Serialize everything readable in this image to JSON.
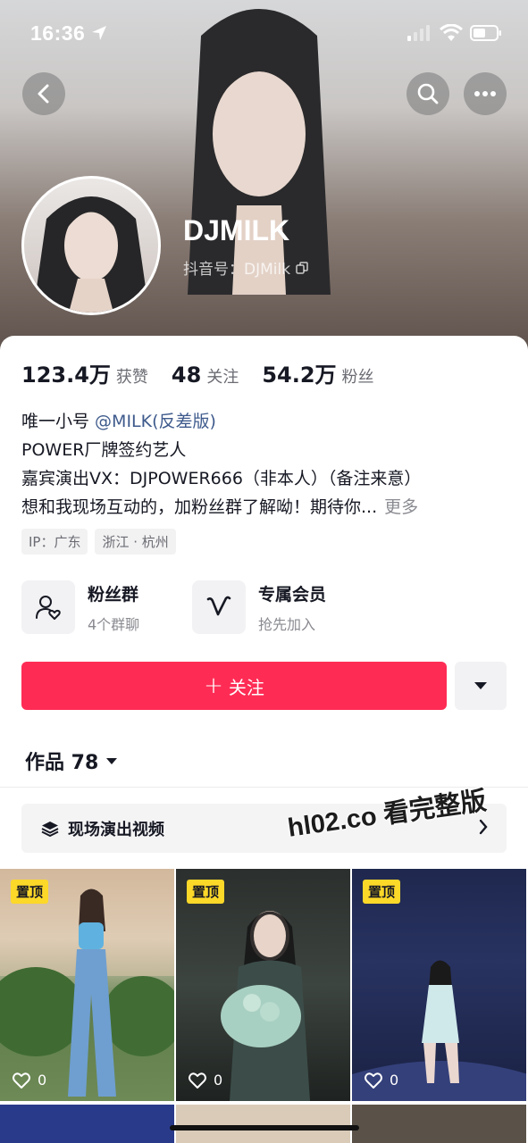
{
  "status_bar": {
    "time": "16:36"
  },
  "header": {
    "username": "DJMILK",
    "douyin_id": "抖音号：DJMilk"
  },
  "stats": [
    {
      "num": "123.4万",
      "label": "获赞"
    },
    {
      "num": "48",
      "label": "关注"
    },
    {
      "num": "54.2万",
      "label": "粉丝"
    }
  ],
  "bio": {
    "line1_prefix": "唯一小号 ",
    "line1_mention": "@MILK(反差版)",
    "line2": "POWER厂牌签约艺人",
    "line3": "嘉宾演出VX：DJPOWER666（非本人）（备注来意）",
    "line4": "想和我现场互动的，加粉丝群了解呦！期待你...",
    "more": "更多"
  },
  "tags": [
    "IP：广东",
    "浙江 · 杭州"
  ],
  "features": [
    {
      "title": "粉丝群",
      "subtitle": "4个群聊",
      "icon": "fan-group-icon"
    },
    {
      "title": "专属会员",
      "subtitle": "抢先加入",
      "icon": "membership-v-icon"
    }
  ],
  "follow_button": {
    "plus": "+",
    "label": "关注"
  },
  "works_tab": {
    "label": "作品 78"
  },
  "collection": {
    "label": "现场演出视频"
  },
  "watermark": "hl02.co 看完整版",
  "videos": [
    {
      "pin": "置顶",
      "likes": "0"
    },
    {
      "pin": "置顶",
      "likes": "0"
    },
    {
      "pin": "置顶",
      "likes": "0"
    }
  ],
  "colors": {
    "accent": "#fe2c55",
    "pin_badge": "#fcd829",
    "mention": "#3e5a8c"
  }
}
